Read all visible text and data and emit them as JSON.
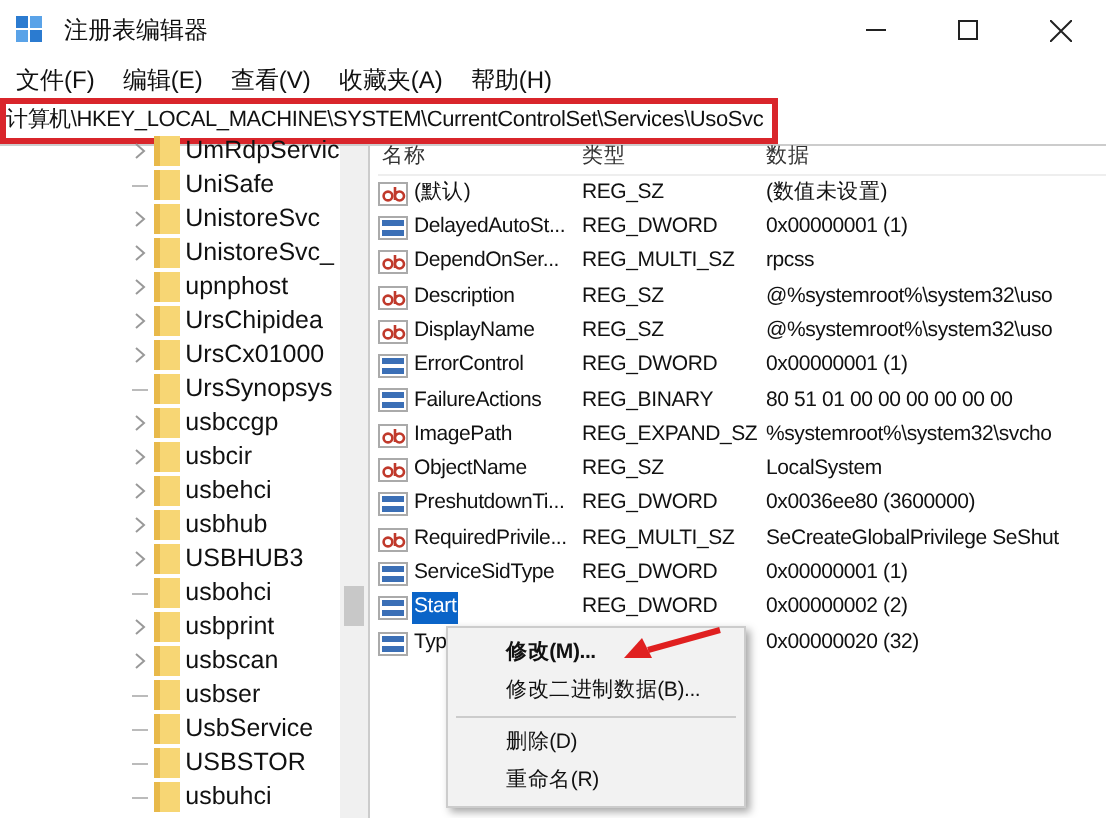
{
  "window": {
    "title": "注册表编辑器"
  },
  "menu": [
    "文件(F)",
    "编辑(E)",
    "查看(V)",
    "收藏夹(A)",
    "帮助(H)"
  ],
  "address": "计算机\\HKEY_LOCAL_MACHINE\\SYSTEM\\CurrentControlSet\\Services\\UsoSvc",
  "tree": [
    {
      "label": "UmRdpServic",
      "expandable": true
    },
    {
      "label": "UniSafe",
      "expandable": false
    },
    {
      "label": "UnistoreSvc",
      "expandable": true
    },
    {
      "label": "UnistoreSvc_",
      "expandable": true
    },
    {
      "label": "upnphost",
      "expandable": true
    },
    {
      "label": "UrsChipidea",
      "expandable": true
    },
    {
      "label": "UrsCx01000",
      "expandable": true
    },
    {
      "label": "UrsSynopsys",
      "expandable": false
    },
    {
      "label": "usbccgp",
      "expandable": true
    },
    {
      "label": "usbcir",
      "expandable": true
    },
    {
      "label": "usbehci",
      "expandable": true
    },
    {
      "label": "usbhub",
      "expandable": true
    },
    {
      "label": "USBHUB3",
      "expandable": true
    },
    {
      "label": "usbohci",
      "expandable": false
    },
    {
      "label": "usbprint",
      "expandable": true
    },
    {
      "label": "usbscan",
      "expandable": true
    },
    {
      "label": "usbser",
      "expandable": false
    },
    {
      "label": "UsbService",
      "expandable": false
    },
    {
      "label": "USBSTOR",
      "expandable": false
    },
    {
      "label": "usbuhci",
      "expandable": false
    }
  ],
  "table": {
    "columns": [
      "名称",
      "类型",
      "数据"
    ],
    "rows": [
      {
        "kind": "string",
        "name": "(默认)",
        "type": "REG_SZ",
        "data": "(数值未设置)",
        "selected": false
      },
      {
        "kind": "binary",
        "name": "DelayedAutoSt...",
        "type": "REG_DWORD",
        "data": "0x00000001 (1)",
        "selected": false
      },
      {
        "kind": "string",
        "name": "DependOnSer...",
        "type": "REG_MULTI_SZ",
        "data": "rpcss",
        "selected": false
      },
      {
        "kind": "string",
        "name": "Description",
        "type": "REG_SZ",
        "data": "@%systemroot%\\system32\\uso",
        "selected": false
      },
      {
        "kind": "string",
        "name": "DisplayName",
        "type": "REG_SZ",
        "data": "@%systemroot%\\system32\\uso",
        "selected": false
      },
      {
        "kind": "binary",
        "name": "ErrorControl",
        "type": "REG_DWORD",
        "data": "0x00000001 (1)",
        "selected": false
      },
      {
        "kind": "binary",
        "name": "FailureActions",
        "type": "REG_BINARY",
        "data": "80 51 01 00 00 00 00 00 00",
        "selected": false
      },
      {
        "kind": "string",
        "name": "ImagePath",
        "type": "REG_EXPAND_SZ",
        "data": "%systemroot%\\system32\\svcho",
        "selected": false
      },
      {
        "kind": "string",
        "name": "ObjectName",
        "type": "REG_SZ",
        "data": "LocalSystem",
        "selected": false
      },
      {
        "kind": "binary",
        "name": "PreshutdownTi...",
        "type": "REG_DWORD",
        "data": "0x0036ee80 (3600000)",
        "selected": false
      },
      {
        "kind": "string",
        "name": "RequiredPrivile...",
        "type": "REG_MULTI_SZ",
        "data": "SeCreateGlobalPrivilege SeShut",
        "selected": false
      },
      {
        "kind": "binary",
        "name": "ServiceSidType",
        "type": "REG_DWORD",
        "data": "0x00000001 (1)",
        "selected": false
      },
      {
        "kind": "binary",
        "name": "Start",
        "type": "REG_DWORD",
        "data": "0x00000002 (2)",
        "selected": true
      },
      {
        "kind": "binary",
        "name": "Typ",
        "data": "0x00000020 (32)",
        "selected": false
      }
    ]
  },
  "context_menu": [
    {
      "kind": "item",
      "label": "修改(M)...",
      "bold": true
    },
    {
      "kind": "item",
      "label": "修改二进制数据(B)...",
      "bold": false
    },
    {
      "kind": "separator"
    },
    {
      "kind": "item",
      "label": "删除(D)",
      "bold": false
    },
    {
      "kind": "item",
      "label": "重命名(R)",
      "bold": false
    }
  ]
}
